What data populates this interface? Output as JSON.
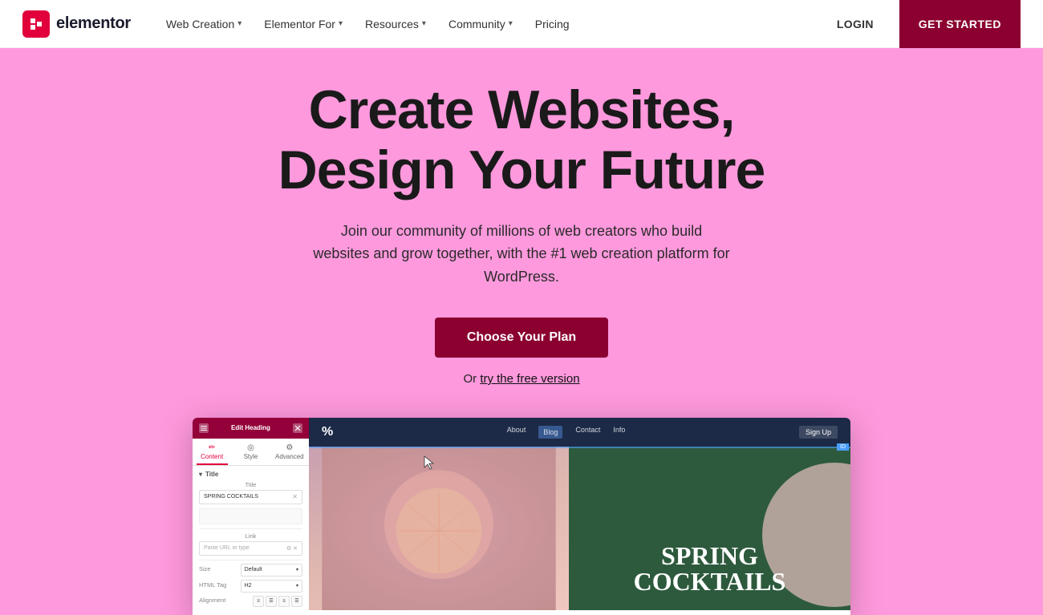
{
  "nav": {
    "logo_text": "elementor",
    "links": [
      {
        "label": "Web Creation",
        "has_dropdown": true
      },
      {
        "label": "Elementor For",
        "has_dropdown": true
      },
      {
        "label": "Resources",
        "has_dropdown": true
      },
      {
        "label": "Community",
        "has_dropdown": true
      },
      {
        "label": "Pricing",
        "has_dropdown": false
      }
    ],
    "login_label": "LOGIN",
    "get_started_label": "GET STARTED"
  },
  "hero": {
    "title_line1": "Create Websites,",
    "title_line2": "Design Your Future",
    "subtitle": "Join our community of millions of web creators who build websites and grow together, with the #1 web creation platform for WordPress.",
    "cta_label": "Choose Your Plan",
    "free_text": "Or ",
    "free_link": "try the free version"
  },
  "editor": {
    "topbar_title": "Edit Heading",
    "tabs": [
      {
        "label": "Content",
        "icon": "✏️"
      },
      {
        "label": "Style",
        "icon": "🎨"
      },
      {
        "label": "Advanced",
        "icon": "⚙️"
      }
    ],
    "section_title": "Title",
    "field_title_label": "Title",
    "field_title_value": "SPRING COCKTAILS",
    "field_link_label": "Link",
    "field_link_placeholder": "Paste URL or type",
    "field_size_label": "Size",
    "field_size_value": "Default",
    "field_htmltag_label": "HTML Tag",
    "field_htmltag_value": "H2",
    "field_alignment_label": "Alignment"
  },
  "site_preview": {
    "logo": "%",
    "nav_links": [
      "About",
      "Blog",
      "Contact",
      "Info"
    ],
    "nav_signup": "Sign Up",
    "heading": "SPRING COCKTAILS"
  },
  "colors": {
    "hero_bg": "#ff99dd",
    "nav_bg": "#ffffff",
    "cta_bg": "#8b0030",
    "elementor_red": "#e1003c",
    "site_dark_nav": "#1c2a47",
    "site_green": "#2d5a3d"
  }
}
